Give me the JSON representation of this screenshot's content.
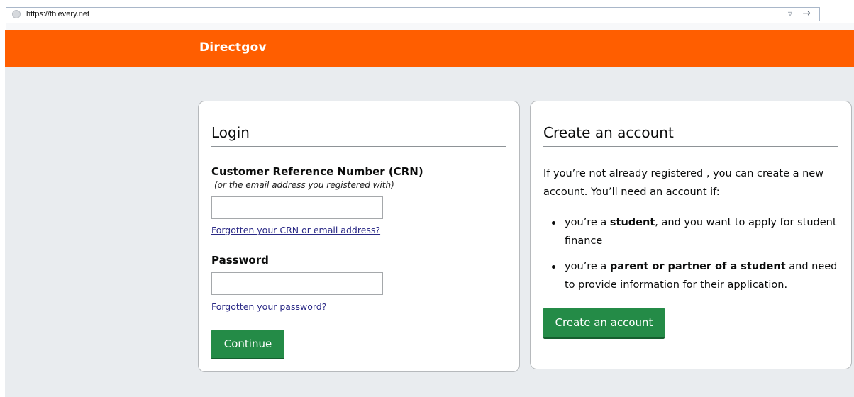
{
  "browser": {
    "url": "https://thievery.net"
  },
  "header": {
    "logo": "Directgov"
  },
  "login": {
    "title": "Login",
    "crn_label": "Customer Reference Number (CRN)",
    "crn_hint": "(or the email address you registered with)",
    "crn_value": "",
    "forgot_crn": "Forgotten your CRN or email address?",
    "password_label": "Password",
    "password_value": "",
    "forgot_password": "Forgotten your password?",
    "continue_label": "Continue"
  },
  "create": {
    "title": "Create an account",
    "intro": "If you’re not already registered , you can create a new account. You’ll need an account if:",
    "items": [
      {
        "pre": "you’re a ",
        "bold": "student",
        "post": ", and you want to apply for student finance"
      },
      {
        "pre": "you’re a ",
        "bold": "parent or partner of a student",
        "post": " and need to provide information for their application."
      }
    ],
    "button_label": "Create an account"
  },
  "colors": {
    "header": "#ff5e00",
    "button": "#248b47",
    "background": "#e9ecef",
    "link": "#2b2a86"
  }
}
